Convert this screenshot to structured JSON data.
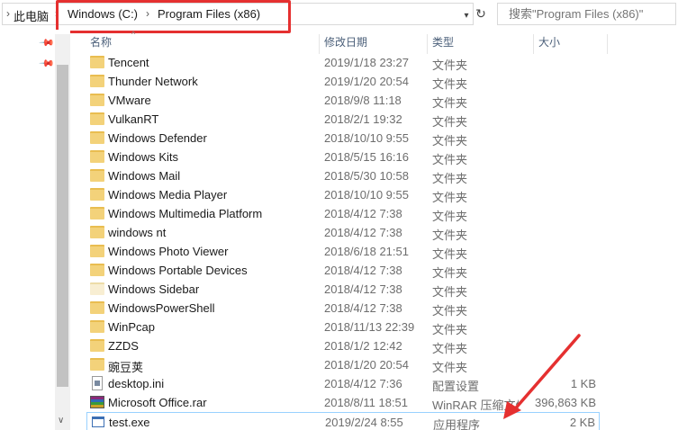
{
  "address_bar": {
    "crumbs": [
      "此电脑",
      "Windows (C:)",
      "Program Files (x86)"
    ],
    "separator": "›",
    "dropdown_icon": "chevron-down-icon",
    "refresh_icon": "refresh-icon"
  },
  "search": {
    "placeholder": "搜索\"Program Files (x86)\""
  },
  "columns": {
    "name": "名称",
    "date": "修改日期",
    "type": "类型",
    "size": "大小"
  },
  "files": [
    {
      "name": "Tencent",
      "date": "2019/1/18 23:27",
      "type": "文件夹",
      "size": "",
      "icon": "folder-icon"
    },
    {
      "name": "Thunder Network",
      "date": "2019/1/20 20:54",
      "type": "文件夹",
      "size": "",
      "icon": "folder-icon"
    },
    {
      "name": "VMware",
      "date": "2018/9/8 11:18",
      "type": "文件夹",
      "size": "",
      "icon": "folder-icon"
    },
    {
      "name": "VulkanRT",
      "date": "2018/2/1 19:32",
      "type": "文件夹",
      "size": "",
      "icon": "folder-icon"
    },
    {
      "name": "Windows Defender",
      "date": "2018/10/10 9:55",
      "type": "文件夹",
      "size": "",
      "icon": "folder-icon"
    },
    {
      "name": "Windows Kits",
      "date": "2018/5/15 16:16",
      "type": "文件夹",
      "size": "",
      "icon": "folder-icon"
    },
    {
      "name": "Windows Mail",
      "date": "2018/5/30 10:58",
      "type": "文件夹",
      "size": "",
      "icon": "folder-icon"
    },
    {
      "name": "Windows Media Player",
      "date": "2018/10/10 9:55",
      "type": "文件夹",
      "size": "",
      "icon": "folder-icon"
    },
    {
      "name": "Windows Multimedia Platform",
      "date": "2018/4/12 7:38",
      "type": "文件夹",
      "size": "",
      "icon": "folder-icon"
    },
    {
      "name": "windows nt",
      "date": "2018/4/12 7:38",
      "type": "文件夹",
      "size": "",
      "icon": "folder-icon"
    },
    {
      "name": "Windows Photo Viewer",
      "date": "2018/6/18 21:51",
      "type": "文件夹",
      "size": "",
      "icon": "folder-icon"
    },
    {
      "name": "Windows Portable Devices",
      "date": "2018/4/12 7:38",
      "type": "文件夹",
      "size": "",
      "icon": "folder-icon"
    },
    {
      "name": "Windows Sidebar",
      "date": "2018/4/12 7:38",
      "type": "文件夹",
      "size": "",
      "icon": "folder-icon-light"
    },
    {
      "name": "WindowsPowerShell",
      "date": "2018/4/12 7:38",
      "type": "文件夹",
      "size": "",
      "icon": "folder-icon"
    },
    {
      "name": "WinPcap",
      "date": "2018/11/13 22:39",
      "type": "文件夹",
      "size": "",
      "icon": "folder-icon"
    },
    {
      "name": "ZZDS",
      "date": "2018/1/2 12:42",
      "type": "文件夹",
      "size": "",
      "icon": "folder-icon"
    },
    {
      "name": "豌豆荚",
      "date": "2018/1/20 20:54",
      "type": "文件夹",
      "size": "",
      "icon": "folder-icon"
    },
    {
      "name": "desktop.ini",
      "date": "2018/4/12 7:36",
      "type": "配置设置",
      "size": "1 KB",
      "icon": "settings-file-icon"
    },
    {
      "name": "Microsoft Office.rar",
      "date": "2018/8/11 18:51",
      "type": "WinRAR 压缩文件",
      "size": "396,863 KB",
      "icon": "rar-archive-icon"
    },
    {
      "name": "test.exe",
      "date": "2019/2/24 8:55",
      "type": "应用程序",
      "size": "2 KB",
      "icon": "exe-application-icon",
      "selected": true
    }
  ],
  "colors": {
    "highlight": "#e53030",
    "selection_border": "#99d1ff",
    "header_text": "#4c607a"
  }
}
